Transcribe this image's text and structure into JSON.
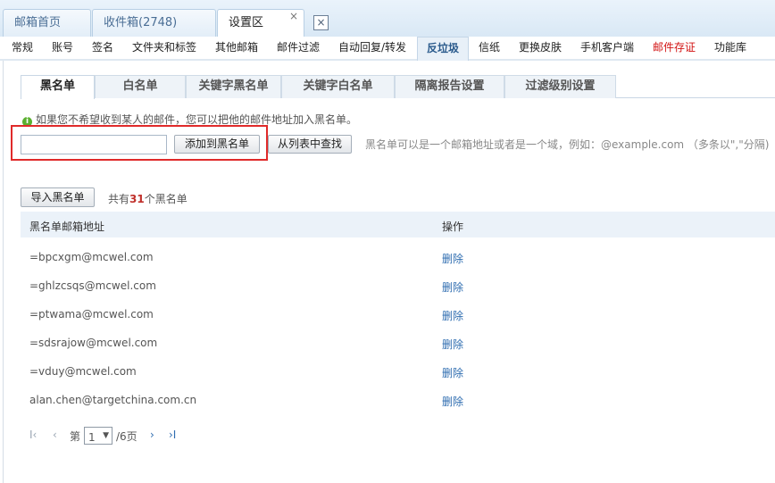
{
  "top_tabs": [
    {
      "label": "邮箱首页"
    },
    {
      "label": "收件箱(2748)"
    },
    {
      "label": "设置区",
      "close": "×"
    }
  ],
  "top_close_all": "×",
  "menu": [
    {
      "label": "常规"
    },
    {
      "label": "账号"
    },
    {
      "label": "签名"
    },
    {
      "label": "文件夹和标签"
    },
    {
      "label": "其他邮箱"
    },
    {
      "label": "邮件过滤"
    },
    {
      "label": "自动回复/转发"
    },
    {
      "label": "反垃圾"
    },
    {
      "label": "信纸"
    },
    {
      "label": "更换皮肤"
    },
    {
      "label": "手机客户端"
    },
    {
      "label": "邮件存证"
    },
    {
      "label": "功能库"
    }
  ],
  "sub_tabs": [
    {
      "label": "黑名单"
    },
    {
      "label": "白名单"
    },
    {
      "label": "关键字黑名单"
    },
    {
      "label": "关键字白名单"
    },
    {
      "label": "隔离报告设置"
    },
    {
      "label": "过滤级别设置"
    }
  ],
  "hint": "如果您不希望收到某人的邮件，您可以把他的邮件地址加入黑名单。",
  "input": {
    "value": "",
    "placeholder": ""
  },
  "buttons": {
    "add": "添加到黑名单",
    "find": "从列表中查找",
    "import": "导入黑名单"
  },
  "help": "黑名单可以是一个邮箱地址或者是一个域，例如：@example.com （多条以\",\"分隔)",
  "count": {
    "prefix": "共有",
    "number": "31",
    "suffix": "个黑名单"
  },
  "table": {
    "headers": {
      "address": "黑名单邮箱地址",
      "action": "操作"
    },
    "rows": [
      {
        "address": "=bpcxgm@mcwel.com",
        "action": "删除"
      },
      {
        "address": "=ghlzcsqs@mcwel.com",
        "action": "删除"
      },
      {
        "address": "=ptwama@mcwel.com",
        "action": "删除"
      },
      {
        "address": "=sdsrajow@mcwel.com",
        "action": "删除"
      },
      {
        "address": "=vduy@mcwel.com",
        "action": "删除"
      },
      {
        "address": "alan.chen@targetchina.com.cn",
        "action": "删除"
      }
    ]
  },
  "pager": {
    "first": "I‹",
    "prev": "‹",
    "page_prefix": "第",
    "current": "1",
    "total": "/6页",
    "next": "›",
    "last": "›I"
  },
  "colors": {
    "accent": "#2f6db0",
    "highlight_box": "#e02a2a",
    "count_number": "#c0302b",
    "menu_red": "#d21414"
  }
}
